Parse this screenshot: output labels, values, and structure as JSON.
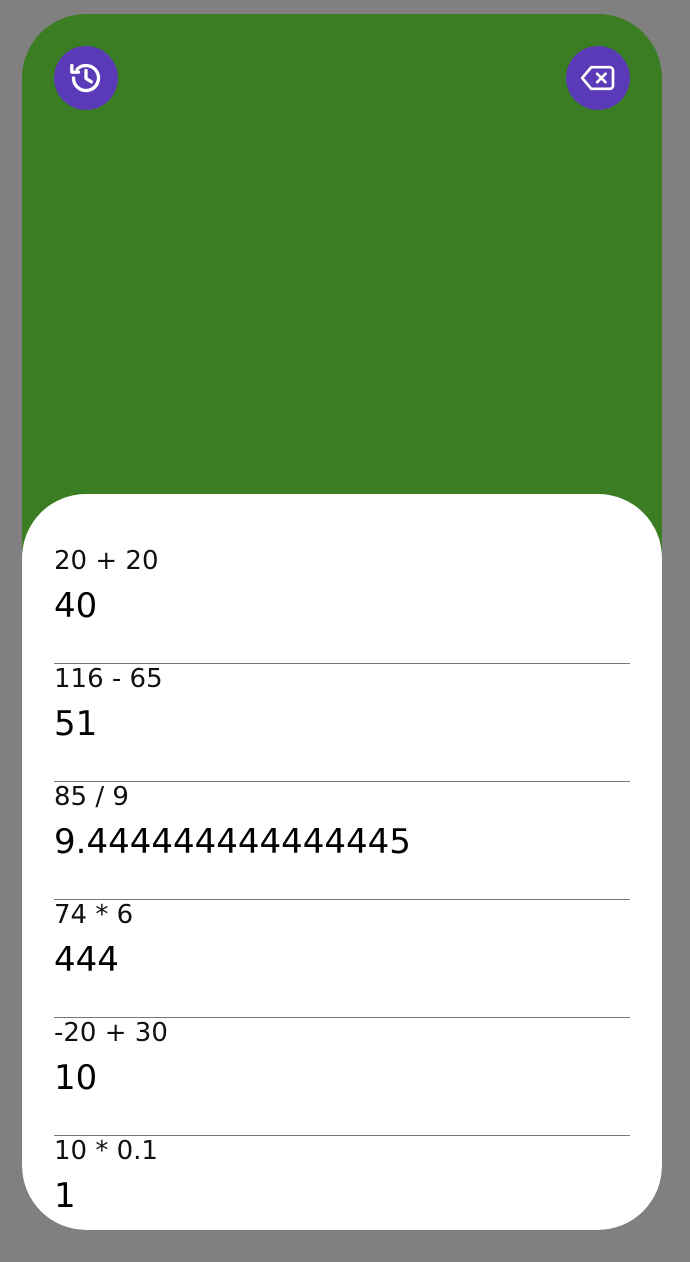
{
  "colors": {
    "page_background": "#808080",
    "header_background": "#3a7d22",
    "button_background": "#5b3ab7",
    "sheet_background": "#ffffff"
  },
  "header": {
    "history_button_icon": "history-icon",
    "backspace_button_icon": "backspace-icon"
  },
  "history": {
    "entries": [
      {
        "expression": "20 + 20",
        "result": "40"
      },
      {
        "expression": "116 - 65",
        "result": "51"
      },
      {
        "expression": "85 / 9",
        "result": "9.444444444444445"
      },
      {
        "expression": "74 * 6",
        "result": "444"
      },
      {
        "expression": "-20 + 30",
        "result": "10"
      },
      {
        "expression": "10 * 0.1",
        "result": "1"
      }
    ]
  }
}
